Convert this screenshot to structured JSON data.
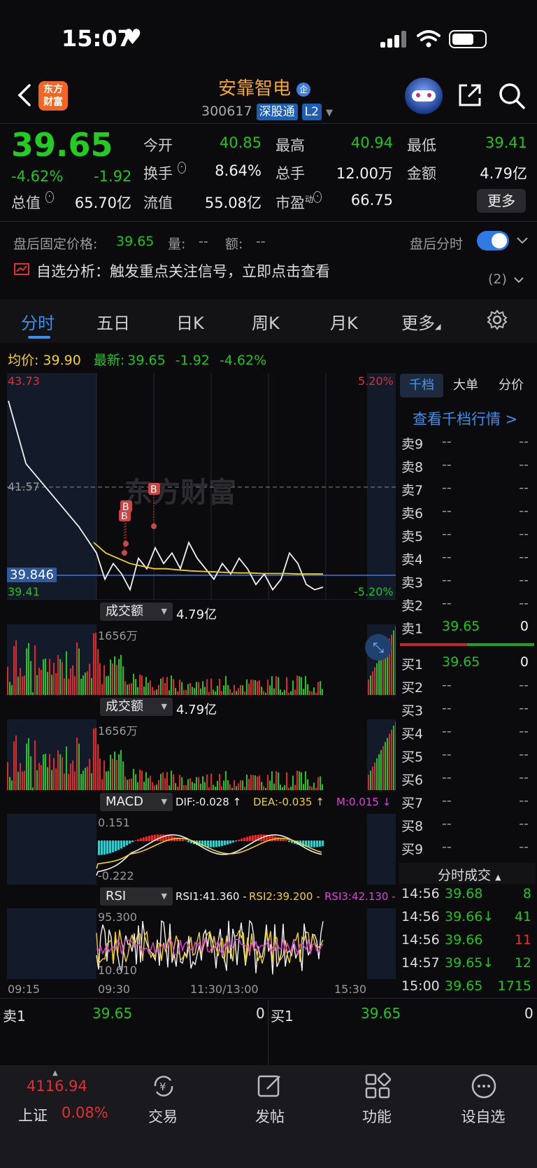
{
  "status_bar": {
    "time": "15:07"
  },
  "header": {
    "stock_name": "安靠智电",
    "badge": "企",
    "stock_code": "300617",
    "tag_market": "深股通",
    "tag_level": "L2",
    "logo_text": "东方财富"
  },
  "quote": {
    "price": "39.65",
    "change_pct": "-4.62%",
    "change": "-1.92",
    "fields": [
      {
        "label": "今开",
        "value": "40.85"
      },
      {
        "label": "最高",
        "value": "40.94"
      },
      {
        "label": "最低",
        "value": "39.41"
      },
      {
        "label": "换手",
        "value": "8.64%"
      },
      {
        "label": "总手",
        "value": "12.00万"
      },
      {
        "label": "金额",
        "value": "4.79亿"
      },
      {
        "label": "总值",
        "value": "65.70亿"
      },
      {
        "label": "流值",
        "value": "55.08亿"
      },
      {
        "label": "市盈",
        "value": "66.75"
      }
    ],
    "pe_superscript": "动",
    "more_label": "更多"
  },
  "after_hours": {
    "label": "盘后固定价格:",
    "price": "39.65",
    "vol_label": "量:",
    "vol": "--",
    "amt_label": "额:",
    "amt": "--",
    "toggle_label": "盘后分时"
  },
  "alert": {
    "text": "自选分析：触发重点关注信号，立即点击查看",
    "count": "(2)"
  },
  "tabs": [
    "分时",
    "五日",
    "日K",
    "周K",
    "月K",
    "更多"
  ],
  "legend": {
    "avg_label": "均价:",
    "avg": "39.90",
    "latest_label": "最新:",
    "latest": "39.65",
    "change": "-1.92",
    "change_pct": "-4.62%"
  },
  "chart_data": {
    "type": "line",
    "title": "",
    "y_max_label": "43.73",
    "y_min_label": "39.41",
    "pct_max_label": "5.20%",
    "pct_min_label": "-5.20%",
    "ref_price_label": "41.57",
    "cursor_price_label": "39.846",
    "x_ticks": [
      "09:15",
      "09:30",
      "11:30/13:00",
      "15:30"
    ],
    "watermark": "东方财富",
    "markers": [
      "B",
      "B",
      "B"
    ],
    "ylim": [
      39.41,
      43.73
    ],
    "series": [
      {
        "name": "price",
        "values": [
          43.2,
          42.0,
          41.6,
          41.2,
          40.8,
          40.3,
          39.8,
          40.1,
          39.9,
          39.6,
          40.2,
          40.0,
          40.4,
          40.1,
          40.3,
          40.0,
          40.5,
          40.2,
          40.0,
          39.8,
          40.1,
          39.9,
          40.2,
          40.0,
          39.7,
          39.9,
          39.6,
          39.8,
          40.3,
          40.1,
          39.7,
          39.6,
          39.65
        ]
      },
      {
        "name": "avg",
        "values": [
          40.5,
          40.3,
          40.2,
          40.1,
          40.05,
          40.0,
          40.0,
          39.98,
          39.96,
          39.95,
          39.94,
          39.93,
          39.92,
          39.92,
          39.91,
          39.91,
          39.91,
          39.9,
          39.9,
          39.9
        ]
      }
    ]
  },
  "volume_panel_1": {
    "label": "成交额",
    "value": "4.79亿",
    "max_label": "1656万"
  },
  "volume_panel_2": {
    "label": "成交额",
    "value": "4.79亿",
    "max_label": "1656万"
  },
  "macd": {
    "label": "MACD",
    "dif": "DIF:-0.028 ↑",
    "dea": "DEA:-0.035 ↑",
    "m": "M:0.015 ↓",
    "max_label": "0.151",
    "min_label": "-0.222"
  },
  "rsi": {
    "label": "RSI",
    "rsi1": "RSI1:41.360 -",
    "rsi2": "RSI2:39.200 -",
    "rsi3": "RSI3:42.130 -",
    "max_label": "95.300",
    "min_label": "10.610"
  },
  "order_book": {
    "tabs": [
      "千档",
      "大单",
      "分价"
    ],
    "link": "查看千档行情 >",
    "asks": [
      {
        "label": "卖9",
        "price": "--",
        "vol": "--"
      },
      {
        "label": "卖8",
        "price": "--",
        "vol": "--"
      },
      {
        "label": "卖7",
        "price": "--",
        "vol": "--"
      },
      {
        "label": "卖6",
        "price": "--",
        "vol": "--"
      },
      {
        "label": "卖5",
        "price": "--",
        "vol": "--"
      },
      {
        "label": "卖4",
        "price": "--",
        "vol": "--"
      },
      {
        "label": "卖3",
        "price": "--",
        "vol": "--"
      },
      {
        "label": "卖2",
        "price": "--",
        "vol": "--"
      },
      {
        "label": "卖1",
        "price": "39.65",
        "vol": "0"
      }
    ],
    "bids": [
      {
        "label": "买1",
        "price": "39.65",
        "vol": "0"
      },
      {
        "label": "买2",
        "price": "--",
        "vol": "--"
      },
      {
        "label": "买3",
        "price": "--",
        "vol": "--"
      },
      {
        "label": "买4",
        "price": "--",
        "vol": "--"
      },
      {
        "label": "买5",
        "price": "--",
        "vol": "--"
      },
      {
        "label": "买6",
        "price": "--",
        "vol": "--"
      },
      {
        "label": "买7",
        "price": "--",
        "vol": "--"
      },
      {
        "label": "买8",
        "price": "--",
        "vol": "--"
      },
      {
        "label": "买9",
        "price": "--",
        "vol": "--"
      }
    ],
    "trades_title": "分时成交",
    "trades": [
      {
        "time": "14:56",
        "price": "39.68",
        "vol": "8"
      },
      {
        "time": "14:56",
        "price": "39.66↓",
        "vol": "41"
      },
      {
        "time": "14:56",
        "price": "39.66",
        "vol": "11"
      },
      {
        "time": "14:57",
        "price": "39.65↓",
        "vol": "12"
      },
      {
        "time": "15:00",
        "price": "39.65",
        "vol": "1715"
      }
    ]
  },
  "bottom_quote": {
    "ask_label": "卖1",
    "ask_price": "39.65",
    "ask_vol": "0",
    "bid_label": "买1",
    "bid_price": "39.65",
    "bid_vol": "0"
  },
  "bottom_nav": {
    "index_value": "4116.94",
    "index_name": "上证",
    "index_change": "0.08%",
    "items": [
      "交易",
      "发帖",
      "功能",
      "设自选"
    ]
  }
}
